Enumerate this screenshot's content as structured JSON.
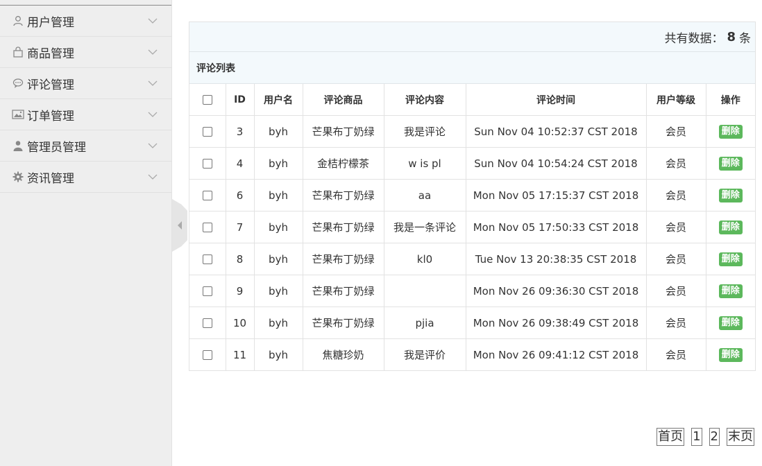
{
  "sidebar": {
    "items": [
      {
        "label": "用户管理",
        "icon": "user-icon"
      },
      {
        "label": "商品管理",
        "icon": "shopping-bag-icon"
      },
      {
        "label": "评论管理",
        "icon": "comment-icon"
      },
      {
        "label": "订单管理",
        "icon": "image-card-icon"
      },
      {
        "label": "管理员管理",
        "icon": "admin-user-icon"
      },
      {
        "label": "资讯管理",
        "icon": "gear-icon"
      }
    ]
  },
  "summary": {
    "prefix": "共有数据：",
    "count": "8",
    "suffix": "条"
  },
  "panel": {
    "title": "评论列表"
  },
  "table": {
    "headers": [
      "ID",
      "用户名",
      "评论商品",
      "评论内容",
      "评论时间",
      "用户等级",
      "操作"
    ],
    "rows": [
      {
        "id": "3",
        "user": "byh",
        "product": "芒果布丁奶绿",
        "content": "我是评论",
        "time": "Sun Nov 04 10:52:37 CST 2018",
        "level": "会员",
        "action": "删除"
      },
      {
        "id": "4",
        "user": "byh",
        "product": "金桔柠檬茶",
        "content": "w is pl",
        "time": "Sun Nov 04 10:54:24 CST 2018",
        "level": "会员",
        "action": "删除"
      },
      {
        "id": "6",
        "user": "byh",
        "product": "芒果布丁奶绿",
        "content": "aa",
        "time": "Mon Nov 05 17:15:37 CST 2018",
        "level": "会员",
        "action": "删除"
      },
      {
        "id": "7",
        "user": "byh",
        "product": "芒果布丁奶绿",
        "content": "我是一条评论",
        "time": "Mon Nov 05 17:50:33 CST 2018",
        "level": "会员",
        "action": "删除"
      },
      {
        "id": "8",
        "user": "byh",
        "product": "芒果布丁奶绿",
        "content": "kl0",
        "time": "Tue Nov 13 20:38:35 CST 2018",
        "level": "会员",
        "action": "删除"
      },
      {
        "id": "9",
        "user": "byh",
        "product": "芒果布丁奶绿",
        "content": "",
        "time": "Mon Nov 26 09:36:30 CST 2018",
        "level": "会员",
        "action": "删除"
      },
      {
        "id": "10",
        "user": "byh",
        "product": "芒果布丁奶绿",
        "content": "pjia",
        "time": "Mon Nov 26 09:38:49 CST 2018",
        "level": "会员",
        "action": "删除"
      },
      {
        "id": "11",
        "user": "byh",
        "product": "焦糖珍奶",
        "content": "我是评价",
        "time": "Mon Nov 26 09:41:12 CST 2018",
        "level": "会员",
        "action": "删除"
      }
    ]
  },
  "pagination": {
    "first": "首页",
    "pages": [
      "1",
      "2"
    ],
    "last": "末页"
  },
  "colors": {
    "delete_button": "#5cb85c",
    "sidebar_bg": "#eeeeee",
    "header_bg": "#f3f9fc"
  }
}
